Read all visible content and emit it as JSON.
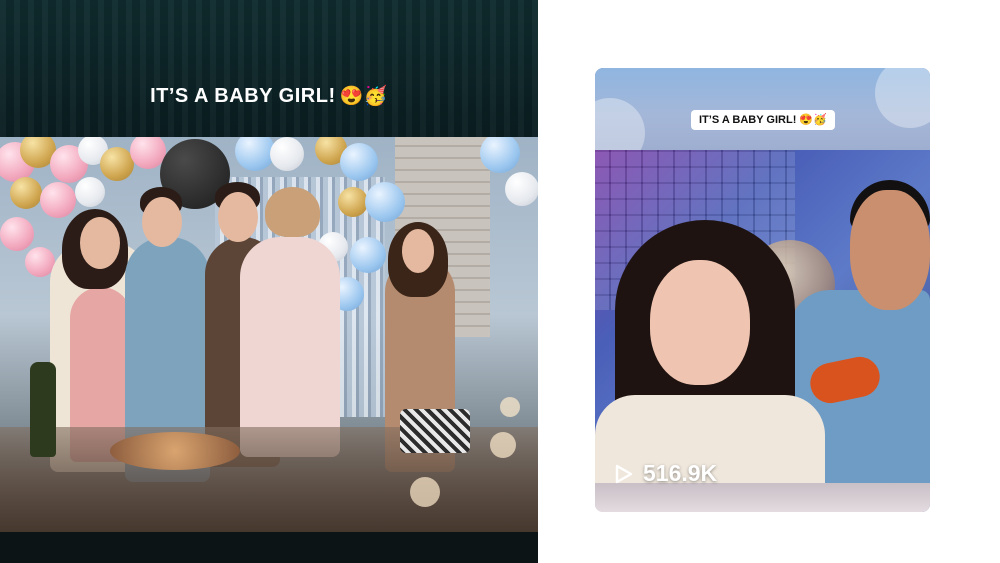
{
  "main_video": {
    "caption": "IT’S A BABY GIRL!",
    "caption_emoji": "😍🥳"
  },
  "thumbnail": {
    "caption": "IT’S A BABY GIRL! 😍🥳",
    "views": "516.9K",
    "play_icon": "play-icon"
  }
}
